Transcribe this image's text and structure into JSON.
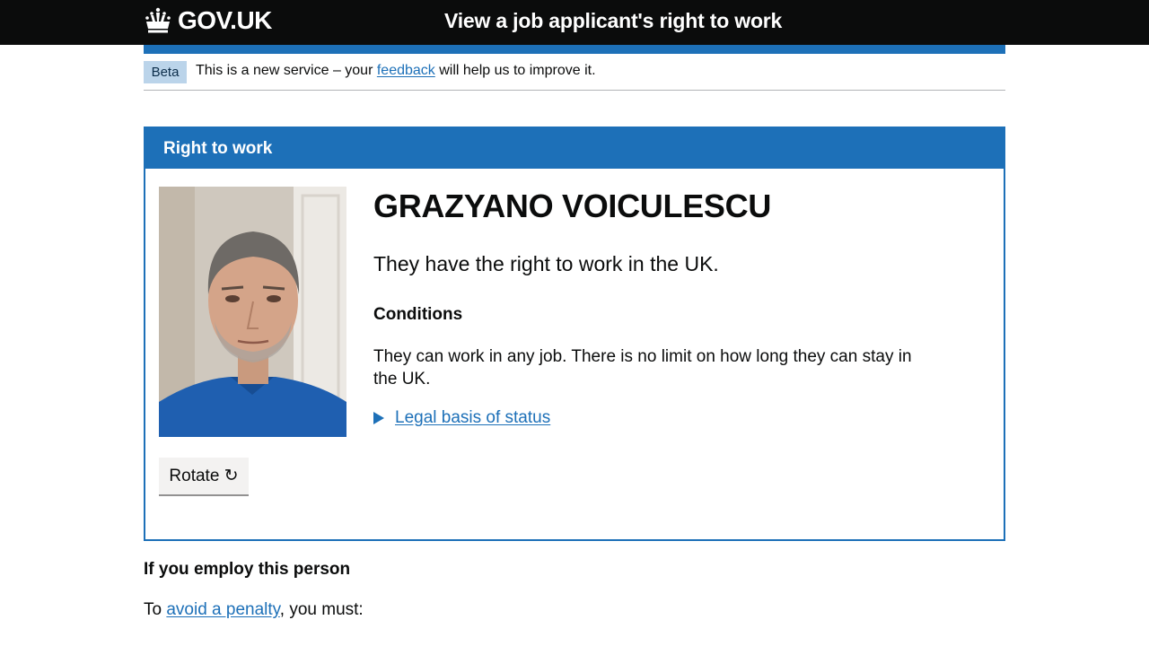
{
  "header": {
    "logo_text": "GOV.UK",
    "service_name": "View a job applicant's right to work",
    "logo_icon": "crown-icon"
  },
  "phase_banner": {
    "tag": "Beta",
    "text_before": "This is a new service – your ",
    "link": "feedback",
    "text_after": " will help us to improve it."
  },
  "panel": {
    "title": "Right to work",
    "name": "GRAZYANO VOICULESCU",
    "status": "They have the right to work in the UK.",
    "conditions_heading": "Conditions",
    "conditions_text": "They can work in any job. There is no limit on how long they can stay in the UK.",
    "details_summary": "Legal basis of status",
    "rotate_button": "Rotate ↻"
  },
  "employ": {
    "heading": "If you employ this person",
    "penalty_before": "To ",
    "penalty_link": "avoid a penalty",
    "penalty_after": ", you must:"
  },
  "colors": {
    "header_bg": "#0b0c0c",
    "brand_blue": "#1d70b8",
    "phase_tag_bg": "#bbd4ea"
  }
}
